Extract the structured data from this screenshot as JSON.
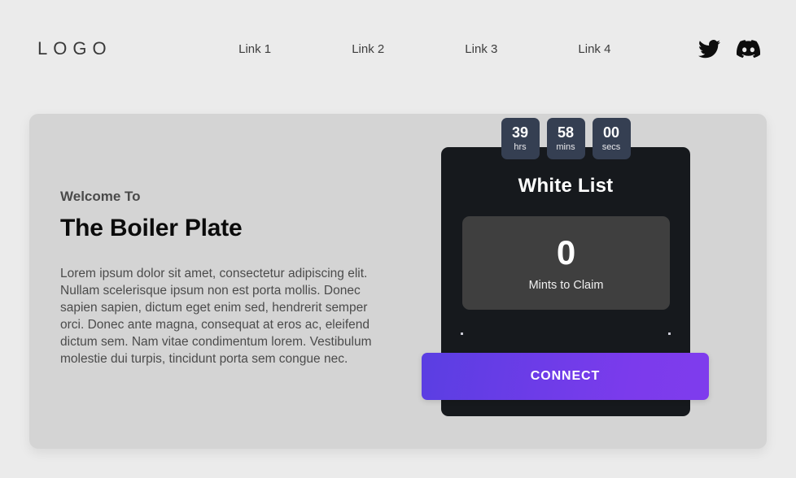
{
  "header": {
    "logo": "LOGO",
    "nav_links": [
      {
        "label": "Link 1"
      },
      {
        "label": "Link 2"
      },
      {
        "label": "Link 3"
      },
      {
        "label": "Link 4"
      }
    ],
    "social": [
      {
        "icon": "twitter-icon",
        "name": "Twitter"
      },
      {
        "icon": "discord-icon",
        "name": "Discord"
      }
    ]
  },
  "hero": {
    "kicker": "Welcome To",
    "title": "The Boiler Plate",
    "paragraph": "Lorem ipsum dolor sit amet, consectetur adipiscing elit. Nullam scelerisque ipsum non est porta mollis. Donec sapien sapien, dictum eget enim sed, hendrerit semper orci. Donec ante magna, consequat at eros ac, eleifend dictum sem. Nam vitae condimentum lorem. Vestibulum molestie dui turpis, tincidunt porta sem congue nec."
  },
  "mint_card": {
    "title": "White List",
    "timer": [
      {
        "value": "39",
        "label": "hrs"
      },
      {
        "value": "58",
        "label": "mins"
      },
      {
        "value": "00",
        "label": "secs"
      }
    ],
    "counter": {
      "value": "0",
      "label": "Mints to Claim"
    },
    "connect_label": "CONNECT"
  },
  "colors": {
    "page_background": "#ebebeb",
    "panel_background": "#d4d4d4",
    "card_background": "#16191d",
    "counter_background": "#3f3f3f",
    "timer_background": "#353f52",
    "accent_purple": "#7b3bec",
    "accent_indigo": "#5a3ee2"
  }
}
